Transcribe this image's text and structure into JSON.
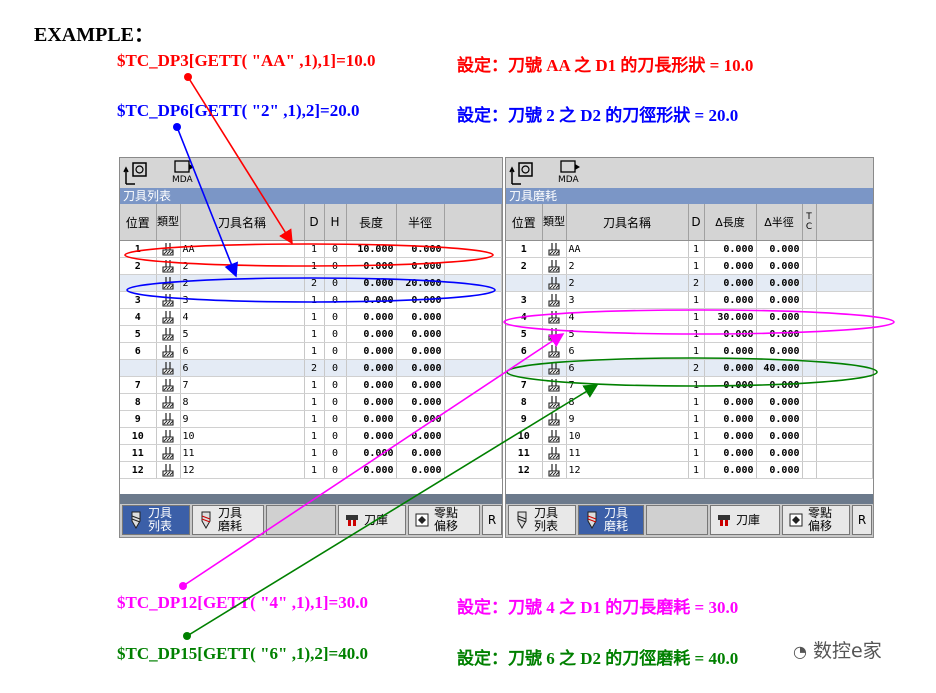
{
  "heading": "EXAMPLE：",
  "annotations": [
    {
      "code": "$TC_DP3[GETT( \"AA\" ,1),1]=10.0",
      "desc": "設定：刀號 AA 之 D1 的刀長形狀 = 10.0",
      "color": "#ff0000"
    },
    {
      "code": "$TC_DP6[GETT( \"2\" ,1),2]=20.0",
      "desc": "設定：刀號 2 之 D2 的刀徑形狀 = 20.0",
      "color": "#0000ff"
    },
    {
      "code": "$TC_DP12[GETT( \"4\" ,1),1]=30.0",
      "desc": "設定：刀號 4 之 D1 的刀長磨耗 = 30.0",
      "color": "#ff00ff"
    },
    {
      "code": "$TC_DP15[GETT( \"6\" ,1),2]=40.0",
      "desc": "設定：刀號 6 之 D2 的刀徑磨耗 = 40.0",
      "color": "#008000"
    }
  ],
  "left_panel": {
    "mode_label": "MDA",
    "title": "刀具列表",
    "headers": [
      "位置",
      "類型",
      "刀具名稱",
      "D",
      "H",
      "長度",
      "半徑"
    ],
    "rows": [
      {
        "pos": "1",
        "name": "AA",
        "d": "1",
        "h": "0",
        "len": "10.000",
        "rad": "0.000"
      },
      {
        "pos": "2",
        "name": "2",
        "d": "1",
        "h": "0",
        "len": "0.000",
        "rad": "0.000"
      },
      {
        "pos": "",
        "name": "2",
        "d": "2",
        "h": "0",
        "len": "0.000",
        "rad": "20.000"
      },
      {
        "pos": "3",
        "name": "3",
        "d": "1",
        "h": "0",
        "len": "0.000",
        "rad": "0.000"
      },
      {
        "pos": "4",
        "name": "4",
        "d": "1",
        "h": "0",
        "len": "0.000",
        "rad": "0.000"
      },
      {
        "pos": "5",
        "name": "5",
        "d": "1",
        "h": "0",
        "len": "0.000",
        "rad": "0.000"
      },
      {
        "pos": "6",
        "name": "6",
        "d": "1",
        "h": "0",
        "len": "0.000",
        "rad": "0.000"
      },
      {
        "pos": "",
        "name": "6",
        "d": "2",
        "h": "0",
        "len": "0.000",
        "rad": "0.000"
      },
      {
        "pos": "7",
        "name": "7",
        "d": "1",
        "h": "0",
        "len": "0.000",
        "rad": "0.000"
      },
      {
        "pos": "8",
        "name": "8",
        "d": "1",
        "h": "0",
        "len": "0.000",
        "rad": "0.000"
      },
      {
        "pos": "9",
        "name": "9",
        "d": "1",
        "h": "0",
        "len": "0.000",
        "rad": "0.000"
      },
      {
        "pos": "10",
        "name": "10",
        "d": "1",
        "h": "0",
        "len": "0.000",
        "rad": "0.000"
      },
      {
        "pos": "11",
        "name": "11",
        "d": "1",
        "h": "0",
        "len": "0.000",
        "rad": "0.000"
      },
      {
        "pos": "12",
        "name": "12",
        "d": "1",
        "h": "0",
        "len": "0.000",
        "rad": "0.000"
      }
    ],
    "softkeys": [
      "刀具\n列表",
      "刀具\n磨耗",
      "",
      "刀庫",
      "零點\n偏移",
      "R"
    ]
  },
  "right_panel": {
    "mode_label": "MDA",
    "title": "刀具磨耗",
    "headers": [
      "位置",
      "類型",
      "刀具名稱",
      "D",
      "Δ長度",
      "Δ半徑",
      "T C"
    ],
    "rows": [
      {
        "pos": "1",
        "name": "AA",
        "d": "1",
        "dlen": "0.000",
        "drad": "0.000"
      },
      {
        "pos": "2",
        "name": "2",
        "d": "1",
        "dlen": "0.000",
        "drad": "0.000"
      },
      {
        "pos": "",
        "name": "2",
        "d": "2",
        "dlen": "0.000",
        "drad": "0.000"
      },
      {
        "pos": "3",
        "name": "3",
        "d": "1",
        "dlen": "0.000",
        "drad": "0.000"
      },
      {
        "pos": "4",
        "name": "4",
        "d": "1",
        "dlen": "30.000",
        "drad": "0.000"
      },
      {
        "pos": "5",
        "name": "5",
        "d": "1",
        "dlen": "0.000",
        "drad": "0.000"
      },
      {
        "pos": "6",
        "name": "6",
        "d": "1",
        "dlen": "0.000",
        "drad": "0.000"
      },
      {
        "pos": "",
        "name": "6",
        "d": "2",
        "dlen": "0.000",
        "drad": "40.000"
      },
      {
        "pos": "7",
        "name": "7",
        "d": "1",
        "dlen": "0.000",
        "drad": "0.000"
      },
      {
        "pos": "8",
        "name": "8",
        "d": "1",
        "dlen": "0.000",
        "drad": "0.000"
      },
      {
        "pos": "9",
        "name": "9",
        "d": "1",
        "dlen": "0.000",
        "drad": "0.000"
      },
      {
        "pos": "10",
        "name": "10",
        "d": "1",
        "dlen": "0.000",
        "drad": "0.000"
      },
      {
        "pos": "11",
        "name": "11",
        "d": "1",
        "dlen": "0.000",
        "drad": "0.000"
      },
      {
        "pos": "12",
        "name": "12",
        "d": "1",
        "dlen": "0.000",
        "drad": "0.000"
      }
    ],
    "softkeys": [
      "刀具\n列表",
      "刀具\n磨耗",
      "",
      "刀庫",
      "零點\n偏移",
      "R"
    ]
  },
  "watermark": "数控e家"
}
